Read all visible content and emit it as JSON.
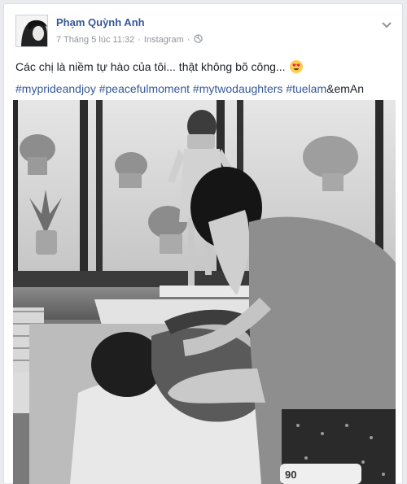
{
  "post": {
    "author": "Phạm Quỳnh Anh",
    "date": "7 Tháng 5 lúc 11:32",
    "separator": "·",
    "source": "Instagram",
    "privacy_icon": "globe-icon",
    "message": "Các chị là niềm tự hào của tôi... thật không bõ công...",
    "emoji": "heart-eyes-emoji",
    "hashtags": [
      "#myprideandjoy",
      "#peacefulmoment",
      "#mytwodaughters",
      "#tuelam"
    ],
    "hashtag_suffix": "&emAn",
    "menu_icon": "chevron-down-icon"
  },
  "photo": {
    "lotion_label": "90",
    "description_icon": "photo"
  },
  "colors": {
    "link": "#365899",
    "meta": "#90949c",
    "text": "#1d2129",
    "background": "#e9ebee"
  }
}
